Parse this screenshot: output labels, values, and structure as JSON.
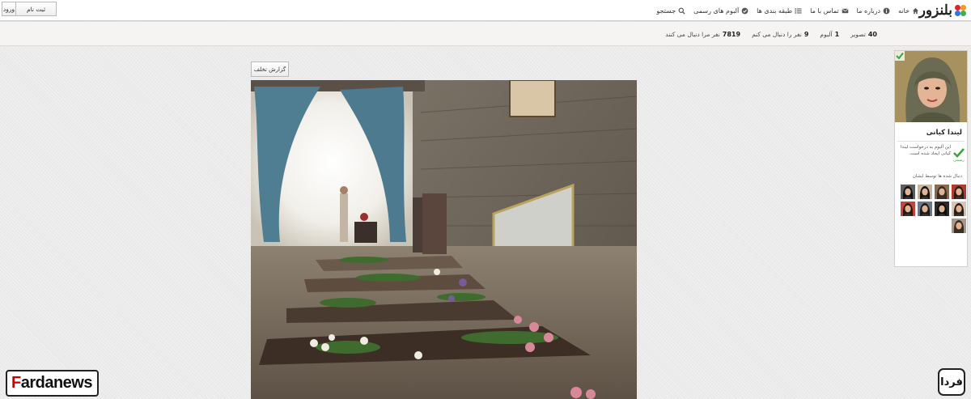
{
  "header": {
    "logo_text": "بلنزور",
    "nav": [
      {
        "id": "home",
        "label": "خانه",
        "icon": "home-icon"
      },
      {
        "id": "about",
        "label": "درباره ما",
        "icon": "info-icon"
      },
      {
        "id": "contact",
        "label": "تماس با ما",
        "icon": "mail-icon"
      },
      {
        "id": "categories",
        "label": "طبقه بندی ها",
        "icon": "list-icon"
      },
      {
        "id": "verified",
        "label": "آلبوم های رسمی",
        "icon": "check-circle-icon"
      },
      {
        "id": "search",
        "label": "جستجو",
        "icon": "search-icon"
      }
    ],
    "login_label": "ورود",
    "register_label": "ثبت نام"
  },
  "stats": {
    "photos_count": "40",
    "photos_label": "تصویر",
    "albums_count": "1",
    "albums_label": "آلبوم",
    "following_count": "9",
    "following_label": "نفر را دنبال می کنم",
    "followers_count": "7819",
    "followers_label": "نفر مرا دنبال می کنند"
  },
  "photo": {
    "report_label": "گزارش تخلف"
  },
  "profile": {
    "name": "لیندا کیانی",
    "verified_text": "این آلبوم به درخواست لیندا کیانی ایجاد شده است.",
    "verified_label": "رسمی",
    "followed_title": "دنبال شده ها توسط ایشان",
    "followers": [
      {
        "bg": "#b33a2f",
        "hair": "#2a1b14"
      },
      {
        "bg": "#8a6a4f",
        "hair": "#3a2a20"
      },
      {
        "bg": "#c9b8a0",
        "hair": "#1a1410"
      },
      {
        "bg": "#5e5e5e",
        "hair": "#111111"
      },
      {
        "bg": "#d7c6b4",
        "hair": "#2b1e17"
      },
      {
        "bg": "#2b2b2b",
        "hair": "#0e0e0e"
      },
      {
        "bg": "#6b7a86",
        "hair": "#1b1b1b"
      },
      {
        "bg": "#c2463c",
        "hair": "#241a15"
      },
      {
        "bg": "#a89a8b",
        "hair": "#3b2d22"
      }
    ]
  },
  "watermarks": {
    "left": "Fardanews",
    "right": "فردا"
  },
  "colors": {
    "accent_green": "#3aa83a",
    "logo_red": "#d8262d",
    "logo_orange": "#f29a1e",
    "logo_blue": "#2a7bd8",
    "logo_green": "#3fb04b"
  }
}
